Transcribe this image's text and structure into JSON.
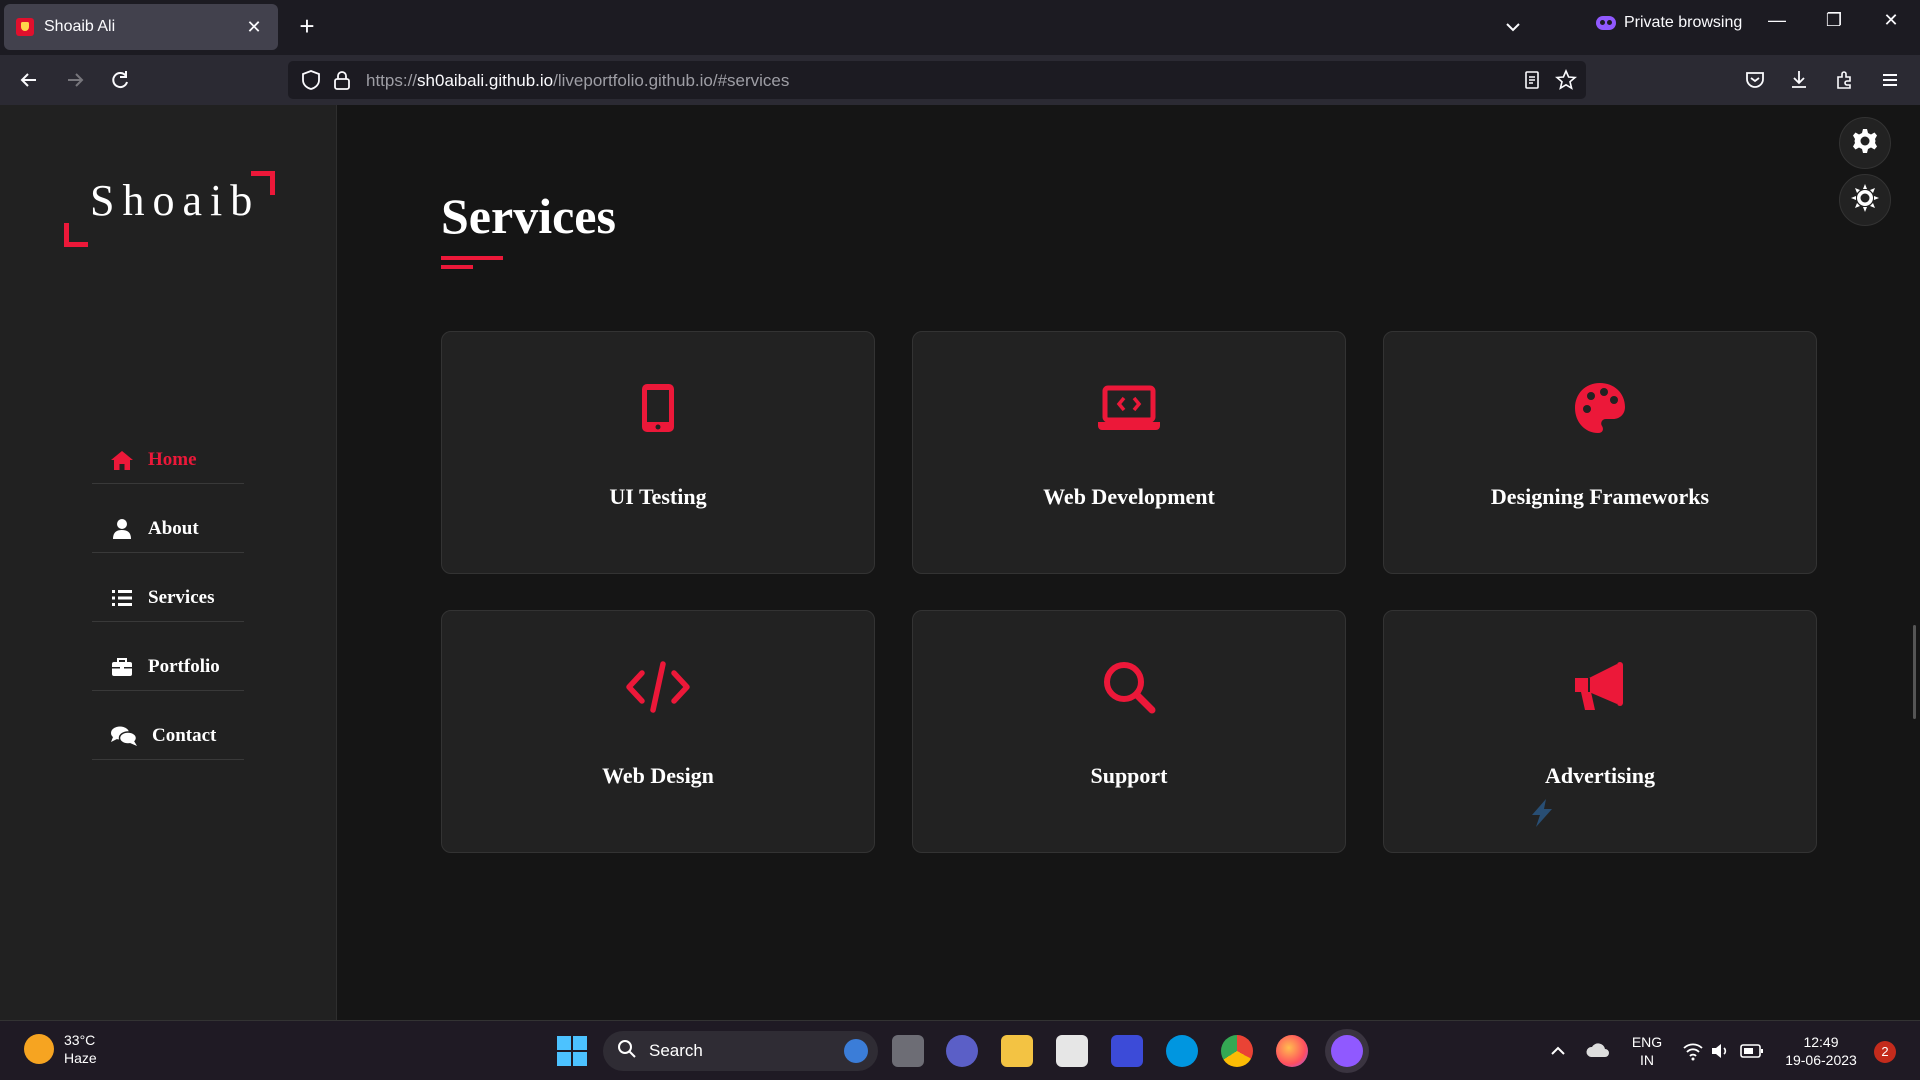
{
  "browser": {
    "tab_title": "Shoaib Ali",
    "tab_close": "✕",
    "new_tab": "+",
    "private_label": "Private browsing",
    "url_prefix": "https://",
    "url_domain": "sh0aibali.github.io",
    "url_path": "/liveportfolio.github.io/#services",
    "win_min": "—",
    "win_restore": "❐",
    "win_close": "✕"
  },
  "sidebar": {
    "logo_text": "Shoaib",
    "nav": [
      {
        "label": "Home",
        "icon": "home-icon",
        "active": true
      },
      {
        "label": "About",
        "icon": "user-icon",
        "active": false
      },
      {
        "label": "Services",
        "icon": "list-icon",
        "active": false
      },
      {
        "label": "Portfolio",
        "icon": "briefcase-icon",
        "active": false
      },
      {
        "label": "Contact",
        "icon": "comments-icon",
        "active": false
      }
    ]
  },
  "main": {
    "title": "Services",
    "services": [
      {
        "label": "UI Testing",
        "icon": "mobile-icon"
      },
      {
        "label": "Web Development",
        "icon": "laptop-code-icon"
      },
      {
        "label": "Designing Frameworks",
        "icon": "palette-icon"
      },
      {
        "label": "Web Design",
        "icon": "code-icon"
      },
      {
        "label": "Support",
        "icon": "search-icon"
      },
      {
        "label": "Advertising",
        "icon": "bullhorn-icon"
      }
    ]
  },
  "taskbar": {
    "temperature": "33°C",
    "condition": "Haze",
    "search_label": "Search",
    "lang_top": "ENG",
    "lang_bottom": "IN",
    "time": "12:49",
    "date": "19-06-2023",
    "notifications": "2"
  },
  "colors": {
    "accent": "#ec1839",
    "sidebar_bg": "#212121",
    "page_bg": "#151515",
    "card_bg": "#222222"
  }
}
